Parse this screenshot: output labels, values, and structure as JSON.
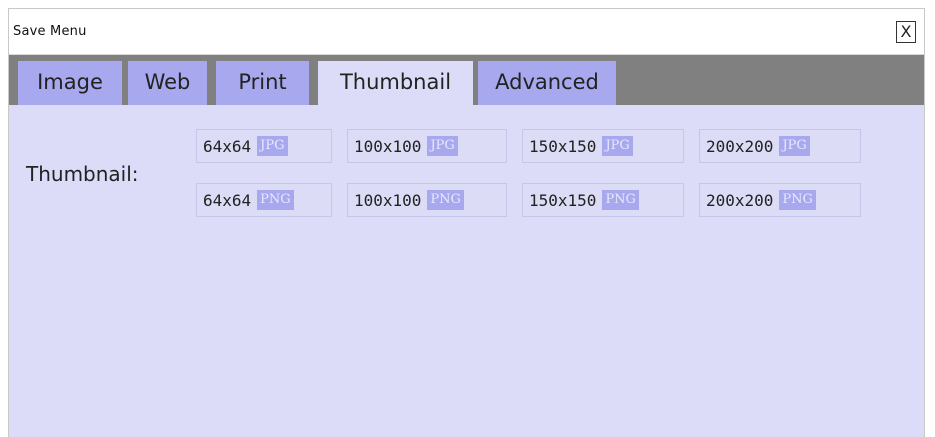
{
  "window": {
    "title": "Save Menu",
    "close_label": "X"
  },
  "tabs": [
    {
      "label": "Image",
      "active": false
    },
    {
      "label": "Web",
      "active": false
    },
    {
      "label": "Print",
      "active": false
    },
    {
      "label": "Thumbnail",
      "active": true
    },
    {
      "label": "Advanced",
      "active": false
    }
  ],
  "thumbnail": {
    "row_label": "Thumbnail:",
    "jpg_row": [
      {
        "size": "64x64",
        "format": "JPG"
      },
      {
        "size": "100x100",
        "format": "JPG"
      },
      {
        "size": "150x150",
        "format": "JPG"
      },
      {
        "size": "200x200",
        "format": "JPG"
      }
    ],
    "png_row": [
      {
        "size": "64x64",
        "format": "PNG"
      },
      {
        "size": "100x100",
        "format": "PNG"
      },
      {
        "size": "150x150",
        "format": "PNG"
      },
      {
        "size": "200x200",
        "format": "PNG"
      }
    ]
  },
  "colors": {
    "background": "#dcdcf8",
    "tab_bar": "#808080",
    "tab": "#a8a8ee",
    "format_badge": "#a8a8ee"
  }
}
